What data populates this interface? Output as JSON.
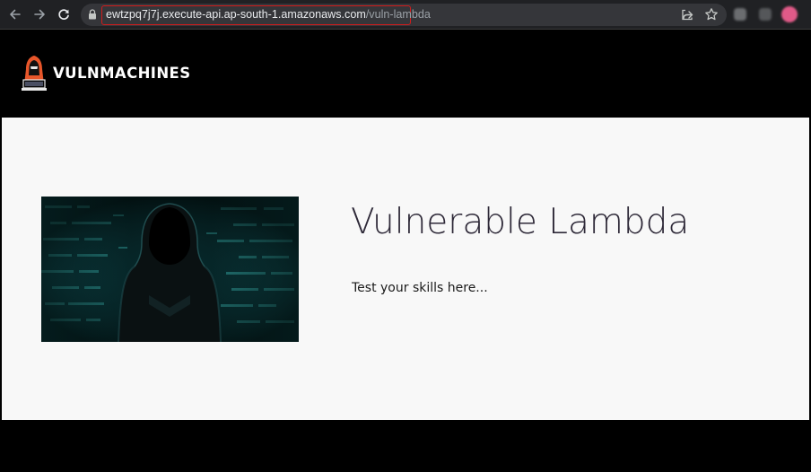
{
  "browser": {
    "url_host": "ewtzpq7j7j.execute-api.ap-south-1.amazonaws.com",
    "url_path": "/vuln-lambda",
    "icons": [
      "back-arrow-icon",
      "forward-arrow-icon",
      "reload-icon",
      "lock-icon",
      "share-icon",
      "star-icon",
      "extension-icon",
      "profile-avatar"
    ]
  },
  "site": {
    "brand": "VULNMACHINES",
    "logo_icon": "hooded-hacker-logo-icon"
  },
  "hero": {
    "title": "Vulnerable Lambda",
    "subtitle": "Test your skills here...",
    "image": "hooded-hacker-image"
  },
  "colors": {
    "toolbar_bg": "#202124",
    "omnibox_bg": "#35363a",
    "url_highlight": "#d01c1c",
    "header_bg": "#000000",
    "hero_bg": "#f8f8f8",
    "title_color": "#2e2938",
    "logo_accent": "#e8562a"
  }
}
